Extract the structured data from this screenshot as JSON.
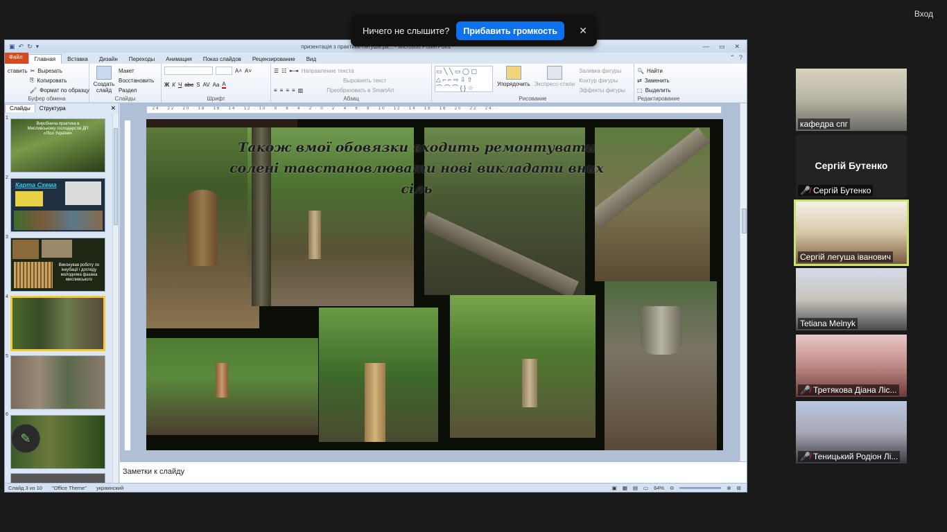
{
  "zoom_banner": {
    "message": "Ничего не слышите?",
    "button": "Прибавить громкость",
    "close": "✕"
  },
  "login": "Вход",
  "ppt": {
    "window_title": "призентація з практики-легуша.ра... - Microsoft PowerPoint",
    "qat_icons": [
      "save-icon",
      "undo-icon",
      "redo-icon"
    ],
    "tabs": [
      "Файл",
      "Главная",
      "Вставка",
      "Дизайн",
      "Переходы",
      "Анимация",
      "Показ слайдов",
      "Рецензирование",
      "Вид"
    ],
    "active_tab": "Главная",
    "ribbon": {
      "clipboard": {
        "name": "Буфер обмена",
        "paste": "ставить",
        "cut": "Вырезать",
        "copy": "Копировать",
        "format_painter": "Формат по образцу"
      },
      "slides": {
        "name": "Слайды",
        "new_slide": "Создать слайд",
        "layout": "Макет",
        "reset": "Восстановить",
        "section": "Раздел"
      },
      "font": {
        "name": "Шрифт",
        "bold": "Ж",
        "italic": "К",
        "underline": "Ч",
        "strike": "abc",
        "shadow": "S",
        "spacing": "AV",
        "case": "Aa",
        "color": "A"
      },
      "paragraph": {
        "name": "Абзац",
        "text_direction": "Направление текста",
        "align_text": "Выровнять текст",
        "smartart": "Преобразовать в SmartArt"
      },
      "drawing": {
        "name": "Рисование",
        "arrange": "Упорядочить",
        "quick_styles": "Экспресс-стили",
        "fill": "Заливка фигуры",
        "outline": "Контур фигуры",
        "effects": "Эффекты фигуры"
      },
      "editing": {
        "name": "Редактирование",
        "find": "Найти",
        "replace": "Заменить",
        "select": "Выделить"
      }
    },
    "left_pane": {
      "tab_slides": "Слайды",
      "tab_outline": "Структура",
      "close": "✕",
      "thumbnails": [
        {
          "num": "1",
          "text": "Виробнича практика в Мисливському господарстві ДП «Ліси України»"
        },
        {
          "num": "2",
          "text": "Карта Схема"
        },
        {
          "num": "3",
          "text": "Виконував роботу по інкубації і догляду молодняка фазана мисливського"
        },
        {
          "num": "4",
          "text": ""
        },
        {
          "num": "5",
          "text": ""
        },
        {
          "num": "6",
          "text": ""
        }
      ]
    },
    "ruler_text": "· 24 · 22 · 20 · 18 · 16 · 14 · 12 · 10 · 8 · 6 · 4 · 2 · 0 · 2 · 4 · 6 · 8 · 10 · 12 · 14 · 16 · 18 · 20 · 22 · 24 ·",
    "slide": {
      "title": "Також вмої обовязки входить ремонтувати солені тавстановлювати нові викладати вних сіль"
    },
    "notes_placeholder": "Заметки к слайду",
    "status": {
      "slide_info": "Слайд 3 из 10",
      "theme": "\"Office Theme\"",
      "language": "украинский",
      "zoom": "64%"
    }
  },
  "participants": [
    {
      "name": "кафедра спг",
      "muted": false,
      "video": true,
      "active": false
    },
    {
      "name": "Сергій Бутенко",
      "muted": true,
      "video": false,
      "active": false,
      "display_name": "Сергій Бутенко"
    },
    {
      "name": "Сергій легуша іванович",
      "muted": false,
      "video": true,
      "active": true
    },
    {
      "name": "Tetiana Melnyk",
      "muted": false,
      "video": true,
      "active": false
    },
    {
      "name": "Третякова Діана  Ліс...",
      "muted": true,
      "video": true,
      "active": false
    },
    {
      "name": "Теницький Родіон Лі...",
      "muted": true,
      "video": true,
      "active": false
    }
  ],
  "colors": {
    "zoom_blue": "#0e72ed",
    "active_speaker": "#c7e36a",
    "ppt_file_tab": "#d44a1f",
    "muted_red": "#e0393e"
  }
}
